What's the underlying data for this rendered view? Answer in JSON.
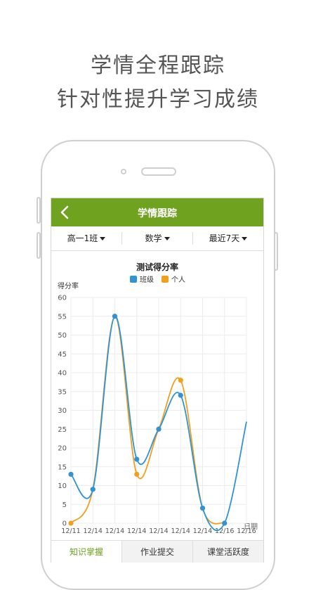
{
  "headline": {
    "line1": "学情全程跟踪",
    "line2": "针对性提升学习成绩"
  },
  "app": {
    "title": "学情跟踪",
    "back_icon": "chevron-left-icon",
    "accent": "#6ea21f"
  },
  "filters": [
    {
      "label": "高一1班"
    },
    {
      "label": "数学"
    },
    {
      "label": "最近7天"
    }
  ],
  "tabs": [
    {
      "label": "知识掌握",
      "active": true
    },
    {
      "label": "作业提交",
      "active": false
    },
    {
      "label": "课堂活跃度",
      "active": false
    }
  ],
  "chart_data": {
    "type": "line",
    "title": "测试得分率",
    "ylabel": "得分率",
    "xlabel": "日期",
    "ylim": [
      0,
      60
    ],
    "yticks": [
      0,
      5,
      10,
      15,
      20,
      25,
      30,
      35,
      40,
      45,
      50,
      55,
      60
    ],
    "categories": [
      "12/11",
      "12/14",
      "12/14",
      "12/14",
      "12/14",
      "12/14",
      "12/14",
      "12/16",
      "12/16"
    ],
    "grid": true,
    "legend_position": "top-center",
    "series": [
      {
        "name": "班级",
        "color": "#2f93d6",
        "values": [
          13,
          9,
          55,
          17,
          25,
          34,
          4,
          0,
          27
        ]
      },
      {
        "name": "个人",
        "color": "#f0a01c",
        "values": [
          0,
          9,
          55,
          13,
          25,
          38,
          4,
          0,
          null
        ]
      }
    ]
  }
}
